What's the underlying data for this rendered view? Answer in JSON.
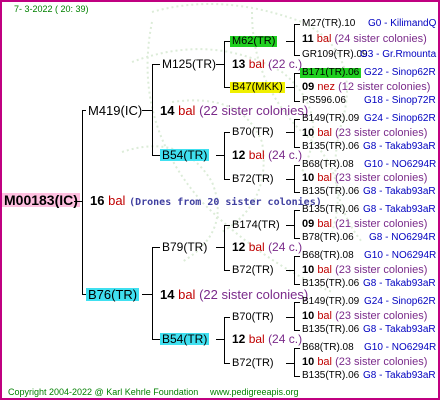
{
  "header": {
    "date": "7-  3-2022  ( 20:  39)"
  },
  "root": {
    "name": "M00183(IC)",
    "color": "#ffc0e0"
  },
  "root_line": {
    "num": "16",
    "bal": "bal",
    "note": "(Drones from 20 sister colonies)"
  },
  "gen1": [
    {
      "name": "M419(IC)",
      "color": "",
      "num": "14",
      "bal": "bal",
      "note": "(22 sister colonies)"
    },
    {
      "name": "B76(TR)",
      "color": "#40e0f0",
      "num": "14",
      "bal": "bal",
      "note": "(22 sister colonies)"
    }
  ],
  "gen2": [
    {
      "name": "M125(TR)",
      "color": "",
      "num": "13",
      "bal": "bal",
      "note": "(22 c.)"
    },
    {
      "name": "B54(TR)",
      "color": "#40e0f0",
      "num": "12",
      "bal": "bal",
      "note": "(24 c.)"
    },
    {
      "name": "B79(TR)",
      "color": "",
      "num": "12",
      "bal": "bal",
      "note": "(24 c.)"
    },
    {
      "name": "B54(TR)",
      "color": "#40e0f0",
      "num": "12",
      "bal": "bal",
      "note": "(24 c.)"
    }
  ],
  "gen3": [
    {
      "name": "M62(TR)",
      "color": "#20d020",
      "num": "11",
      "bal": "bal",
      "note": "(24 sister colonies)"
    },
    {
      "name": "B47(MKK)",
      "color": "#f0f000",
      "num": "09",
      "bal": "nez",
      "note": "(12 sister colonies)"
    },
    {
      "name": "B70(TR)",
      "color": "",
      "num": "10",
      "bal": "bal",
      "note": "(23 sister colonies)"
    },
    {
      "name": "B72(TR)",
      "color": "",
      "num": "10",
      "bal": "bal",
      "note": "(23 sister colonies)"
    },
    {
      "name": "B174(TR)",
      "color": "",
      "num": "09",
      "bal": "bal",
      "note": "(21 sister colonies)"
    },
    {
      "name": "B72(TR)",
      "color": "",
      "num": "10",
      "bal": "bal",
      "note": "(23 sister colonies)"
    },
    {
      "name": "B70(TR)",
      "color": "",
      "num": "10",
      "bal": "bal",
      "note": "(23 sister colonies)"
    },
    {
      "name": "B72(TR)",
      "color": "",
      "num": "10",
      "bal": "bal",
      "note": "(23 sister colonies)"
    }
  ],
  "gen4": [
    {
      "name": "M27(TR).10",
      "color": "",
      "loc": "G0 - KilimandQ"
    },
    {
      "name": "GR109(TR).09",
      "color": "",
      "loc": "G3 - Gr.Rmounta"
    },
    {
      "name": "B171(TR).06",
      "color": "#20d020",
      "loc": "G22 - Sinop62R"
    },
    {
      "name": "PS596.06",
      "color": "",
      "loc": "G18 - Sinop72R"
    },
    {
      "name": "B149(TR).09",
      "color": "",
      "loc": "G24 - Sinop62R"
    },
    {
      "name": "B135(TR).06",
      "color": "",
      "loc": "G8 - Takab93aR"
    },
    {
      "name": "B68(TR).08",
      "color": "",
      "loc": "G10 - NO6294R"
    },
    {
      "name": "B135(TR).06",
      "color": "",
      "loc": "G8 - Takab93aR"
    },
    {
      "name": "B135(TR).06",
      "color": "",
      "loc": "G8 - Takab93aR"
    },
    {
      "name": "B78(TR).06",
      "color": "",
      "loc": "G8 - NO6294R"
    },
    {
      "name": "B68(TR).08",
      "color": "",
      "loc": "G10 - NO6294R"
    },
    {
      "name": "B135(TR).06",
      "color": "",
      "loc": "G8 - Takab93aR"
    },
    {
      "name": "B149(TR).09",
      "color": "",
      "loc": "G24 - Sinop62R"
    },
    {
      "name": "B135(TR).06",
      "color": "",
      "loc": "G8 - Takab93aR"
    },
    {
      "name": "B68(TR).08",
      "color": "",
      "loc": "G10 - NO6294R"
    },
    {
      "name": "B135(TR).06",
      "color": "",
      "loc": "G8 - Takab93aR"
    }
  ],
  "footer": {
    "copyright": "Copyright 2004-2022 @ Karl Kehrle Foundation",
    "site": "www.pedigreeapis.org"
  }
}
